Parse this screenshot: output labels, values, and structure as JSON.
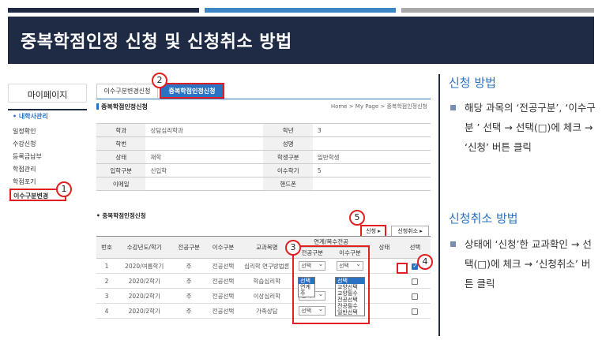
{
  "slide": {
    "title": "중복학점인정 신청 및 신청취소 방법"
  },
  "screenshot": {
    "sidebar": {
      "title": "마이페이지",
      "group": "• 내학사관리",
      "items": [
        "일정확인",
        "수강신청",
        "등록금납부",
        "학점관리",
        "학점포기",
        "이수구분변경"
      ]
    },
    "tabs": [
      "이수구분변경신청",
      "중복학점인정신청"
    ],
    "page_heading": "중복학점인정신청",
    "breadcrumb": "Home > My Page > 중복학점인정신청",
    "info": {
      "rows": [
        [
          "학과",
          "상담심리학과",
          "학년",
          "3"
        ],
        [
          "학번",
          "",
          "성명",
          ""
        ],
        [
          "상태",
          "재학",
          "학생구분",
          "일반학생"
        ],
        [
          "입학구분",
          "신입학",
          "이수학기",
          "5"
        ],
        [
          "이메일",
          "",
          "핸드폰",
          ""
        ]
      ]
    },
    "section_heading": "• 중복학점인정신청",
    "buttons": {
      "apply": "신청 ▸",
      "cancel": "신청취소 ▸"
    },
    "list": {
      "group_header": "연계/복수전공",
      "headers": [
        "번호",
        "수강년도/학기",
        "전공구분",
        "이수구분",
        "교과목명",
        "전공구분",
        "이수구분",
        "상태",
        "선택"
      ],
      "rows": [
        {
          "no": "1",
          "term": "2020/여름학기",
          "major": "주",
          "type": "전공선택",
          "course": "심리학 연구방법론",
          "sel1": "선택",
          "sel2": "선택",
          "status": "",
          "checked": true
        },
        {
          "no": "2",
          "term": "2020/2학기",
          "major": "주",
          "type": "전공선택",
          "course": "학습심리학",
          "sel1": "",
          "sel2": "",
          "status": "",
          "checked": false
        },
        {
          "no": "3",
          "term": "2020/2학기",
          "major": "주",
          "type": "전공선택",
          "course": "이상심리학",
          "sel1": "선택",
          "sel2": "",
          "status": "",
          "checked": false
        },
        {
          "no": "4",
          "term": "2020/2학기",
          "major": "주",
          "type": "전공선택",
          "course": "가족상담",
          "sel1": "선택",
          "sel2": "선택",
          "status": "",
          "checked": false
        }
      ]
    },
    "dropdown_major": [
      "선택",
      "연계",
      "주"
    ],
    "dropdown_type": [
      "선택",
      "교양선택",
      "교양필수",
      "전공선택",
      "전공필수",
      "일반선택"
    ],
    "badges": [
      "1",
      "2",
      "3",
      "4",
      "5"
    ]
  },
  "instructions": {
    "apply_heading": "신청 방법",
    "apply_text": "해당 과목의 ‘전공구분’, ‘이수구분 ’ 선택 → 선택(□)에 체크 → ‘신청’ 버튼 클릭",
    "cancel_heading": "신청취소 방법",
    "cancel_text": "상태에 ‘신청’한 교과확인 → 선택(□)에 체크 → ‘신청취소’ 버튼 클릭"
  },
  "colors": {
    "navy": "#1f2a44",
    "accent": "#2b72c2",
    "highlight": "#e02020"
  }
}
